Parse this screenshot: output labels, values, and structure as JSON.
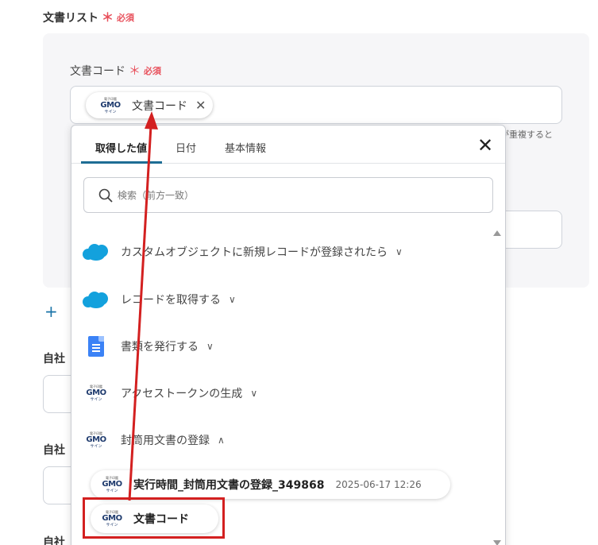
{
  "section": {
    "title": "文書リスト",
    "required_star": "＊",
    "required_label": "必須"
  },
  "field": {
    "label": "文書コード",
    "required_star": "＊",
    "required_label": "必須",
    "hint_tail": "が重複すると"
  },
  "chip": {
    "label": "文書コード",
    "close": "✕"
  },
  "left_labels": {
    "label1": "自社",
    "label2": "自社",
    "label3": "自社"
  },
  "add_icon": "+",
  "popup": {
    "tabs": [
      {
        "label": "取得した値",
        "active": true
      },
      {
        "label": "日付",
        "active": false
      },
      {
        "label": "基本情報",
        "active": false
      }
    ],
    "close": "✕",
    "search_placeholder": "検索（前方一致）",
    "groups": [
      {
        "label": "カスタムオブジェクトに新規レコードが登録されたら",
        "icon": "salesforce-icon",
        "chevron": "∨"
      },
      {
        "label": "レコードを取得する",
        "icon": "salesforce-icon",
        "chevron": "∨"
      },
      {
        "label": "書類を発行する",
        "icon": "google-docs-icon",
        "chevron": "∨"
      },
      {
        "label": "アクセストークンの生成",
        "icon": "gmo-sign-icon",
        "chevron": "∨"
      },
      {
        "label": "封筒用文書の登録",
        "icon": "gmo-sign-icon",
        "chevron": "∧"
      }
    ],
    "items": [
      {
        "label": "実行時間_封筒用文書の登録_349868",
        "meta": "2025-06-17 12:26"
      },
      {
        "label": "文書コード",
        "meta": ""
      }
    ]
  },
  "gmo_logo": {
    "top": "電子印鑑",
    "mid": "GMO",
    "bottom": "サイン"
  },
  "colors": {
    "required": "#e8505b",
    "accent": "#1e6d94",
    "salesforce": "#13a1dd",
    "annotation": "#d32020"
  }
}
